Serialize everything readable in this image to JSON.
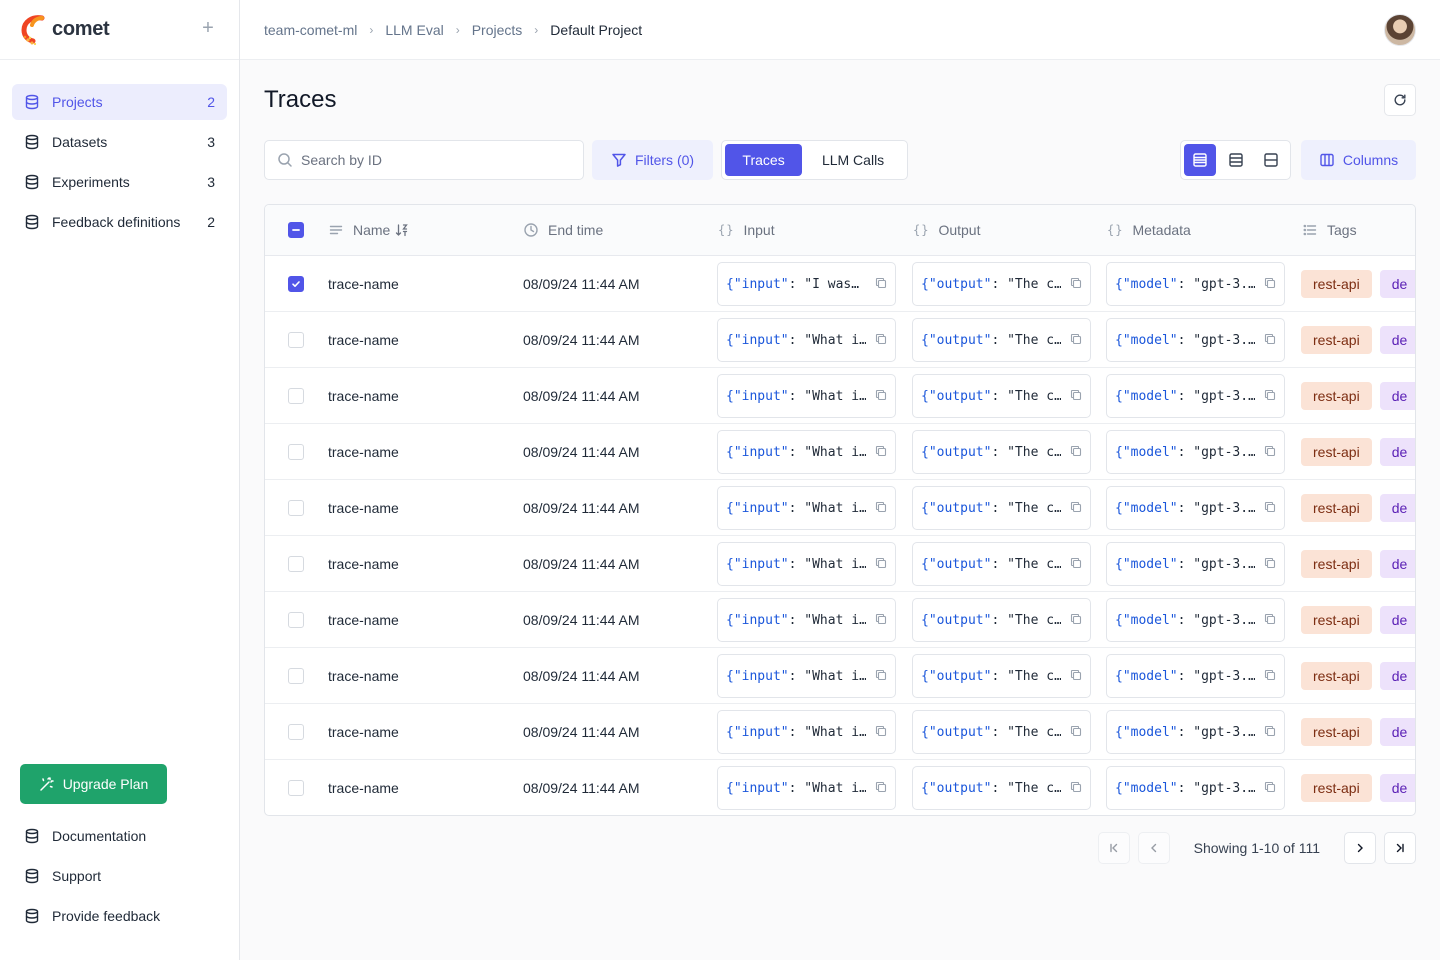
{
  "brand": {
    "name": "comet"
  },
  "sidebar": {
    "items": [
      {
        "label": "Projects",
        "count": "2",
        "active": true
      },
      {
        "label": "Datasets",
        "count": "3",
        "active": false
      },
      {
        "label": "Experiments",
        "count": "3",
        "active": false
      },
      {
        "label": "Feedback definitions",
        "count": "2",
        "active": false
      }
    ],
    "upgrade_label": "Upgrade Plan",
    "bottom_items": [
      {
        "label": "Documentation"
      },
      {
        "label": "Support"
      },
      {
        "label": "Provide feedback"
      }
    ]
  },
  "breadcrumb": {
    "items": [
      "team-comet-ml",
      "LLM Eval",
      "Projects"
    ],
    "current": "Default Project"
  },
  "page": {
    "title": "Traces"
  },
  "toolbar": {
    "search_placeholder": "Search by ID",
    "filters_label": "Filters (0)",
    "view_tabs": [
      {
        "label": "Traces",
        "active": true
      },
      {
        "label": "LLM Calls",
        "active": false
      }
    ],
    "columns_label": "Columns"
  },
  "table": {
    "headers": {
      "name": "Name",
      "end_time": "End time",
      "input": "Input",
      "output": "Output",
      "metadata": "Metadata",
      "tags": "Tags"
    },
    "json_keys": {
      "input": "\"input\"",
      "output": "\"output\"",
      "metadata": "\"model\""
    },
    "rows": [
      {
        "checked": true,
        "name": "trace-name",
        "end_time": "08/09/24 11:44 AM",
        "input": "\"I was…",
        "output": "\"The c…",
        "metadata": "\"gpt-3.…",
        "tags": [
          "rest-api",
          "de"
        ]
      },
      {
        "checked": false,
        "name": "trace-name",
        "end_time": "08/09/24 11:44 AM",
        "input": "\"What i…",
        "output": "\"The c…",
        "metadata": "\"gpt-3.…",
        "tags": [
          "rest-api",
          "de"
        ]
      },
      {
        "checked": false,
        "name": "trace-name",
        "end_time": "08/09/24 11:44 AM",
        "input": "\"What i…",
        "output": "\"The c…",
        "metadata": "\"gpt-3.…",
        "tags": [
          "rest-api",
          "de"
        ]
      },
      {
        "checked": false,
        "name": "trace-name",
        "end_time": "08/09/24 11:44 AM",
        "input": "\"What i…",
        "output": "\"The c…",
        "metadata": "\"gpt-3.…",
        "tags": [
          "rest-api",
          "de"
        ]
      },
      {
        "checked": false,
        "name": "trace-name",
        "end_time": "08/09/24 11:44 AM",
        "input": "\"What i…",
        "output": "\"The c…",
        "metadata": "\"gpt-3.…",
        "tags": [
          "rest-api",
          "de"
        ]
      },
      {
        "checked": false,
        "name": "trace-name",
        "end_time": "08/09/24 11:44 AM",
        "input": "\"What i…",
        "output": "\"The c…",
        "metadata": "\"gpt-3.…",
        "tags": [
          "rest-api",
          "de"
        ]
      },
      {
        "checked": false,
        "name": "trace-name",
        "end_time": "08/09/24 11:44 AM",
        "input": "\"What i…",
        "output": "\"The c…",
        "metadata": "\"gpt-3.…",
        "tags": [
          "rest-api",
          "de"
        ]
      },
      {
        "checked": false,
        "name": "trace-name",
        "end_time": "08/09/24 11:44 AM",
        "input": "\"What i…",
        "output": "\"The c…",
        "metadata": "\"gpt-3.…",
        "tags": [
          "rest-api",
          "de"
        ]
      },
      {
        "checked": false,
        "name": "trace-name",
        "end_time": "08/09/24 11:44 AM",
        "input": "\"What i…",
        "output": "\"The c…",
        "metadata": "\"gpt-3.…",
        "tags": [
          "rest-api",
          "de"
        ]
      },
      {
        "checked": false,
        "name": "trace-name",
        "end_time": "08/09/24 11:44 AM",
        "input": "\"What i…",
        "output": "\"The c…",
        "metadata": "\"gpt-3.…",
        "tags": [
          "rest-api",
          "de"
        ]
      }
    ]
  },
  "pagination": {
    "label": "Showing 1-10 of 111"
  },
  "colors": {
    "accent": "#5155e8",
    "upgrade": "#1fa36b",
    "tag_rest_bg": "#fbe3d6",
    "tag_de_bg": "#ede2fb"
  },
  "icons": {
    "nav": "database-icon",
    "search": "search-icon",
    "filter": "filter-icon",
    "columns": "columns-icon",
    "refresh": "refresh-icon",
    "copy": "copy-icon"
  }
}
